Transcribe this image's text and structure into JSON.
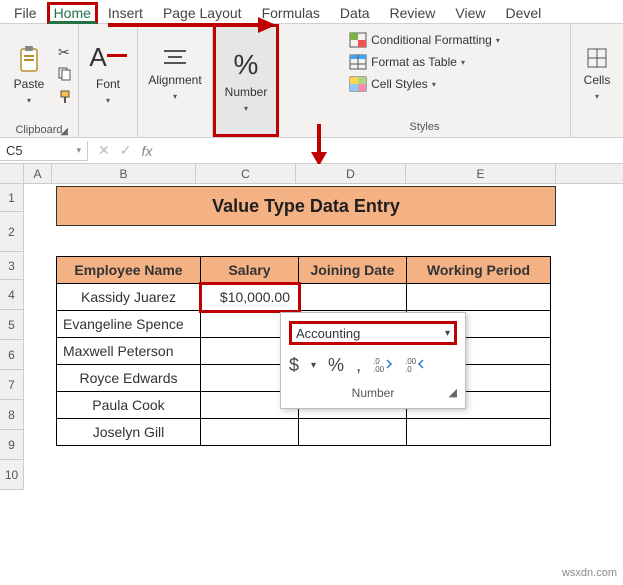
{
  "tabs": {
    "file": "File",
    "home": "Home",
    "insert": "Insert",
    "page_layout": "Page Layout",
    "formulas": "Formulas",
    "data": "Data",
    "review": "Review",
    "view": "View",
    "devel": "Devel"
  },
  "ribbon": {
    "clipboard": {
      "paste": "Paste",
      "label": "Clipboard"
    },
    "font": {
      "btn": "Font"
    },
    "alignment": {
      "btn": "Alignment"
    },
    "number": {
      "btn": "Number"
    },
    "styles": {
      "cond": "Conditional Formatting",
      "fat": "Format as Table",
      "cs": "Cell Styles",
      "label": "Styles"
    },
    "cells": {
      "btn": "Cells"
    }
  },
  "namebox": "C5",
  "popup": {
    "select": "Accounting",
    "label": "Number"
  },
  "sheet": {
    "cols": [
      "A",
      "B",
      "C",
      "D",
      "E"
    ],
    "title": "Value Type Data Entry",
    "headers": [
      "Employee Name",
      "Salary",
      "Joining Date",
      "Working Period"
    ],
    "rows": [
      {
        "name": "Kassidy Juarez",
        "salary": "$10,000.00",
        "jd": "",
        "wp": ""
      },
      {
        "name": "Evangeline Spence",
        "salary": "",
        "jd": "",
        "wp": ""
      },
      {
        "name": "Maxwell Peterson",
        "salary": "",
        "jd": "",
        "wp": ""
      },
      {
        "name": "Royce Edwards",
        "salary": "",
        "jd": "",
        "wp": ""
      },
      {
        "name": "Paula Cook",
        "salary": "",
        "jd": "",
        "wp": ""
      },
      {
        "name": "Joselyn Gill",
        "salary": "",
        "jd": "",
        "wp": ""
      }
    ]
  },
  "watermark": "wsxdn.com",
  "colors": {
    "accent": "#217346",
    "highlight": "#c00000",
    "header_fill": "#f4b183"
  }
}
